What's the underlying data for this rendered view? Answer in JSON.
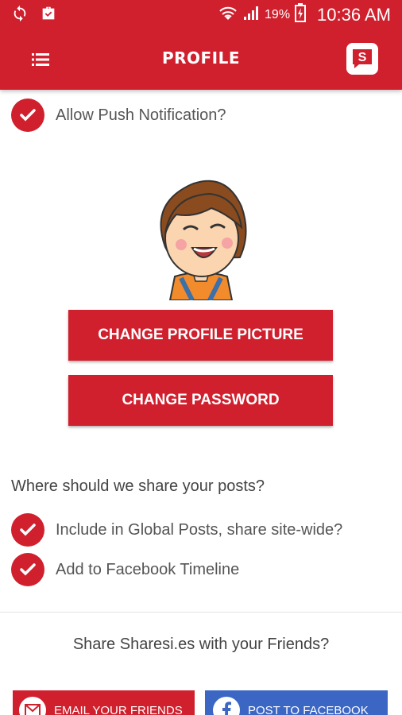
{
  "status_bar": {
    "battery_percent": "19%",
    "time": "10:36 AM"
  },
  "header": {
    "title": "PROFILE"
  },
  "notifications": {
    "label": "Allow Push Notification?",
    "checked": true
  },
  "buttons": {
    "change_picture": "CHANGE PROFILE PICTURE",
    "change_password": "CHANGE PASSWORD"
  },
  "share_settings": {
    "heading": "Where should we share your posts?",
    "options": [
      {
        "label": "Include in Global Posts, share site-wide?",
        "checked": true
      },
      {
        "label": "Add to Facebook Timeline",
        "checked": true
      }
    ]
  },
  "share_friends": {
    "heading": "Share Sharesi.es with your Friends?",
    "email_label": "EMAIL YOUR FRIENDS",
    "facebook_label": "POST TO FACEBOOK"
  },
  "colors": {
    "brand_red": "#d0202e",
    "facebook_blue": "#3b66c4"
  }
}
